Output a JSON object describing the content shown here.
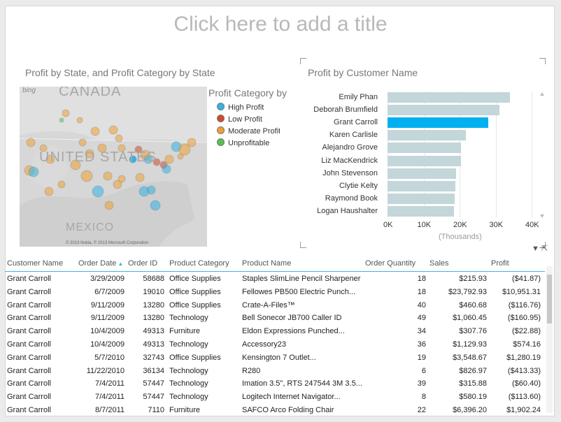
{
  "page": {
    "title_placeholder": "Click here to add a title"
  },
  "map_viz": {
    "title": "Profit by State, and Profit Category by State",
    "bing_label": "bing",
    "labels": {
      "canada": "CANADA",
      "united_states": "UNITED STATES",
      "mexico": "MEXICO"
    },
    "copyright": "© 2013 Nokia, © 2013 Microsoft Corporation",
    "legend": {
      "title": "Profit Category by State",
      "items": [
        {
          "label": "High Profit",
          "color": "#32b3e8"
        },
        {
          "label": "Low Profit",
          "color": "#d04a2b"
        },
        {
          "label": "Moderate Profit",
          "color": "#f0a030"
        },
        {
          "label": "Unprofitable",
          "color": "#56c24c"
        }
      ]
    }
  },
  "chart_data": {
    "type": "bar",
    "title": "Profit by Customer Name",
    "categories": [
      "Emily Phan",
      "Deborah Brumfield",
      "Grant Carroll",
      "Karen Carlisle",
      "Alejandro Grove",
      "Liz MacKendrick",
      "John Stevenson",
      "Clytie Kelty",
      "Raymond Book",
      "Logan Haushalter"
    ],
    "values": [
      34000,
      31000,
      28000,
      21800,
      20400,
      20300,
      19000,
      18800,
      18700,
      18500
    ],
    "highlighted": "Grant Carroll",
    "xlim": [
      0,
      45000
    ],
    "xticks": [
      0,
      10000,
      20000,
      30000,
      40000
    ],
    "xtick_labels": [
      "0K",
      "10K",
      "20K",
      "30K",
      "40K"
    ],
    "xlabel": "(Thousands)",
    "bar_color": "#c3d6da",
    "highlight_color": "#00b0f0"
  },
  "table": {
    "columns": [
      "Customer Name",
      "Order Date",
      "Order ID",
      "Product Category",
      "Product Name",
      "Order Quantity",
      "Sales",
      "Profit"
    ],
    "sort_indicator": "▲",
    "rows": [
      [
        "Grant Carroll",
        "3/29/2009",
        "58688",
        "Office Supplies",
        "Staples SlimLine Pencil Sharpener",
        "18",
        "$215.93",
        "($41.87)"
      ],
      [
        "Grant Carroll",
        "6/7/2009",
        "19010",
        "Office Supplies",
        "Fellowes PB500 Electric Punch...",
        "18",
        "$23,792.93",
        "$10,951.31"
      ],
      [
        "Grant Carroll",
        "9/11/2009",
        "13280",
        "Office Supplies",
        "Crate-A-Files™",
        "40",
        "$460.68",
        "($116.76)"
      ],
      [
        "Grant Carroll",
        "9/11/2009",
        "13280",
        "Technology",
        "Bell Sonecor JB700 Caller ID",
        "49",
        "$1,060.45",
        "($160.95)"
      ],
      [
        "Grant Carroll",
        "10/4/2009",
        "49313",
        "Furniture",
        "Eldon Expressions Punched...",
        "34",
        "$307.76",
        "($22.88)"
      ],
      [
        "Grant Carroll",
        "10/4/2009",
        "49313",
        "Technology",
        "Accessory23",
        "36",
        "$1,129.93",
        "$574.16"
      ],
      [
        "Grant Carroll",
        "5/7/2010",
        "32743",
        "Office Supplies",
        "Kensington 7 Outlet...",
        "19",
        "$3,548.67",
        "$1,280.19"
      ],
      [
        "Grant Carroll",
        "11/22/2010",
        "36134",
        "Technology",
        "R280",
        "6",
        "$826.97",
        "($413.33)"
      ],
      [
        "Grant Carroll",
        "7/4/2011",
        "57447",
        "Technology",
        "Imation 3.5\", RTS 247544 3M 3.5...",
        "39",
        "$315.88",
        "($60.40)"
      ],
      [
        "Grant Carroll",
        "7/4/2011",
        "57447",
        "Technology",
        "Logitech Internet Navigator...",
        "8",
        "$580.19",
        "($113.60)"
      ],
      [
        "Grant Carroll",
        "8/7/2011",
        "7110",
        "Furniture",
        "SAFCO Arco Folding Chair",
        "22",
        "$6,396.20",
        "$1,902.24"
      ]
    ]
  }
}
